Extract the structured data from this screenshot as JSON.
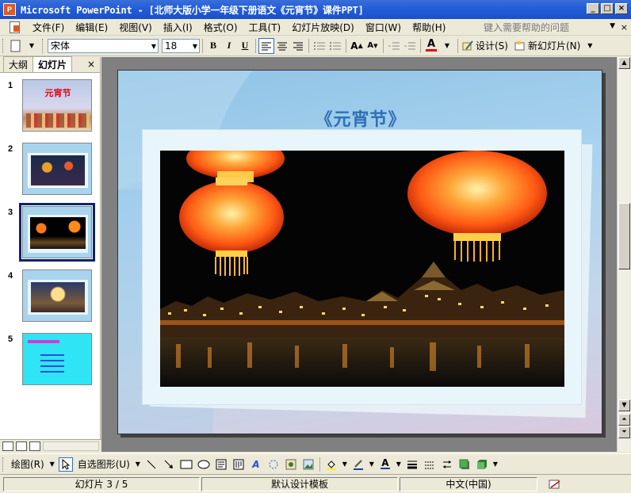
{
  "window": {
    "app_icon_text": "P",
    "title": "Microsoft PowerPoint - [北师大版小学一年级下册语文《元宵节》课件PPT]",
    "minimize": "_",
    "maximize": "□",
    "close": "×"
  },
  "menubar": {
    "items": [
      "文件(F)",
      "编辑(E)",
      "视图(V)",
      "插入(I)",
      "格式(O)",
      "工具(T)",
      "幻灯片放映(D)",
      "窗口(W)",
      "帮助(H)"
    ],
    "help_placeholder": "键入需要帮助的问题",
    "close": "×"
  },
  "toolbar": {
    "font_name": "宋体",
    "font_size": "18",
    "bold": "B",
    "italic": "I",
    "underline": "U",
    "design_label": "设计(S)",
    "new_slide_label": "新幻灯片(N)",
    "font_color": "#e8000b"
  },
  "panel": {
    "tab_outline": "大纲",
    "tab_slides": "幻灯片",
    "close": "×",
    "slides": [
      {
        "num": "1",
        "caption": "元宵节"
      },
      {
        "num": "2",
        "caption": ""
      },
      {
        "num": "3",
        "caption": ""
      },
      {
        "num": "4",
        "caption": ""
      },
      {
        "num": "5",
        "caption": ""
      }
    ],
    "selected_slide": 3
  },
  "slide": {
    "title": "《元宵节》"
  },
  "drawbar": {
    "draw_label": "绘图(R)",
    "autoshapes_label": "自选图形(U)"
  },
  "statusbar": {
    "slide_position": "幻灯片 3 / 5",
    "template": "默认设计模板",
    "language": "中文(中国)"
  },
  "colors": {
    "titlebar": "#245edb",
    "slide_title": "#2e6fb6",
    "selection_border": "#0a246a"
  }
}
